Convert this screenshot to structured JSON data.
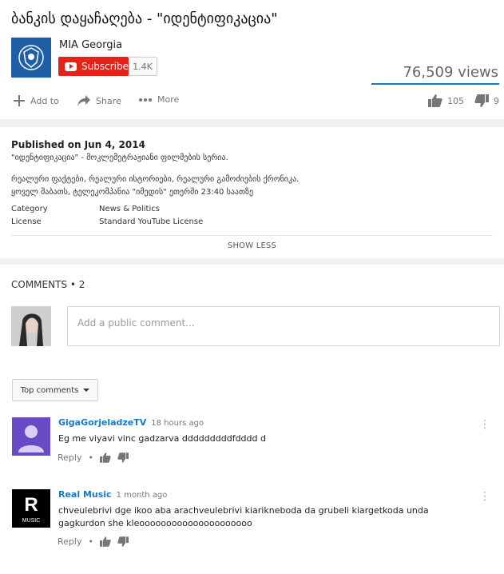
{
  "video": {
    "title": "ბანკის დაყაჩაღება - \"იდენტიფიკაცია\"",
    "views": "76,509 views",
    "view_fraction": 1
  },
  "channel": {
    "name": "MIA Georgia",
    "subscribe_label": "Subscribe",
    "subscriber_count": "1.4K"
  },
  "actions": {
    "add_to": "Add to",
    "share": "Share",
    "more": "More",
    "likes": "105",
    "dislikes": "9"
  },
  "description": {
    "published": "Published on Jun 4, 2014",
    "line1": "\"იდენტიფიკაცია\" - მოკლემეტრაჟიანი ფილმების სერია.",
    "line2": "რეალური ფაქტები, რეალური ისტორიები, რეალური გამოძიების ქრონიკა.",
    "line3": "ყოველ შაბათს, ტელეკომპანია \"იმედის\" ეთერში 23:40 საათზე",
    "category_label": "Category",
    "category_value": "News & Politics",
    "license_label": "License",
    "license_value": "Standard YouTube License",
    "show_less": "SHOW LESS"
  },
  "comments": {
    "header": "COMMENTS • 2",
    "placeholder": "Add a public comment...",
    "sort_label": "Top comments",
    "reply_label": "Reply",
    "reply_sep": "•",
    "items": [
      {
        "author": "GigaGorjeladzeTV",
        "time": "18 hours ago",
        "text": "Eg me viyavi vinc gadzarva dddddddddfdddd d"
      },
      {
        "author": "Real Music",
        "time": "1 month ago",
        "text": "chveulebrivi dge ikoo aba arachveulebrivi kiarikneboda da grubeli kiargetkoda unda gagkurdon she kleooooooooooooooooooooo",
        "avatar_letter": "R",
        "avatar_caption": "MUSIC"
      }
    ]
  },
  "colors": {
    "brand_red": "#e62117",
    "link_blue": "#167ac6",
    "channel_logo": "#1f5fa8",
    "avatar_purple": "#6a4bc6"
  }
}
